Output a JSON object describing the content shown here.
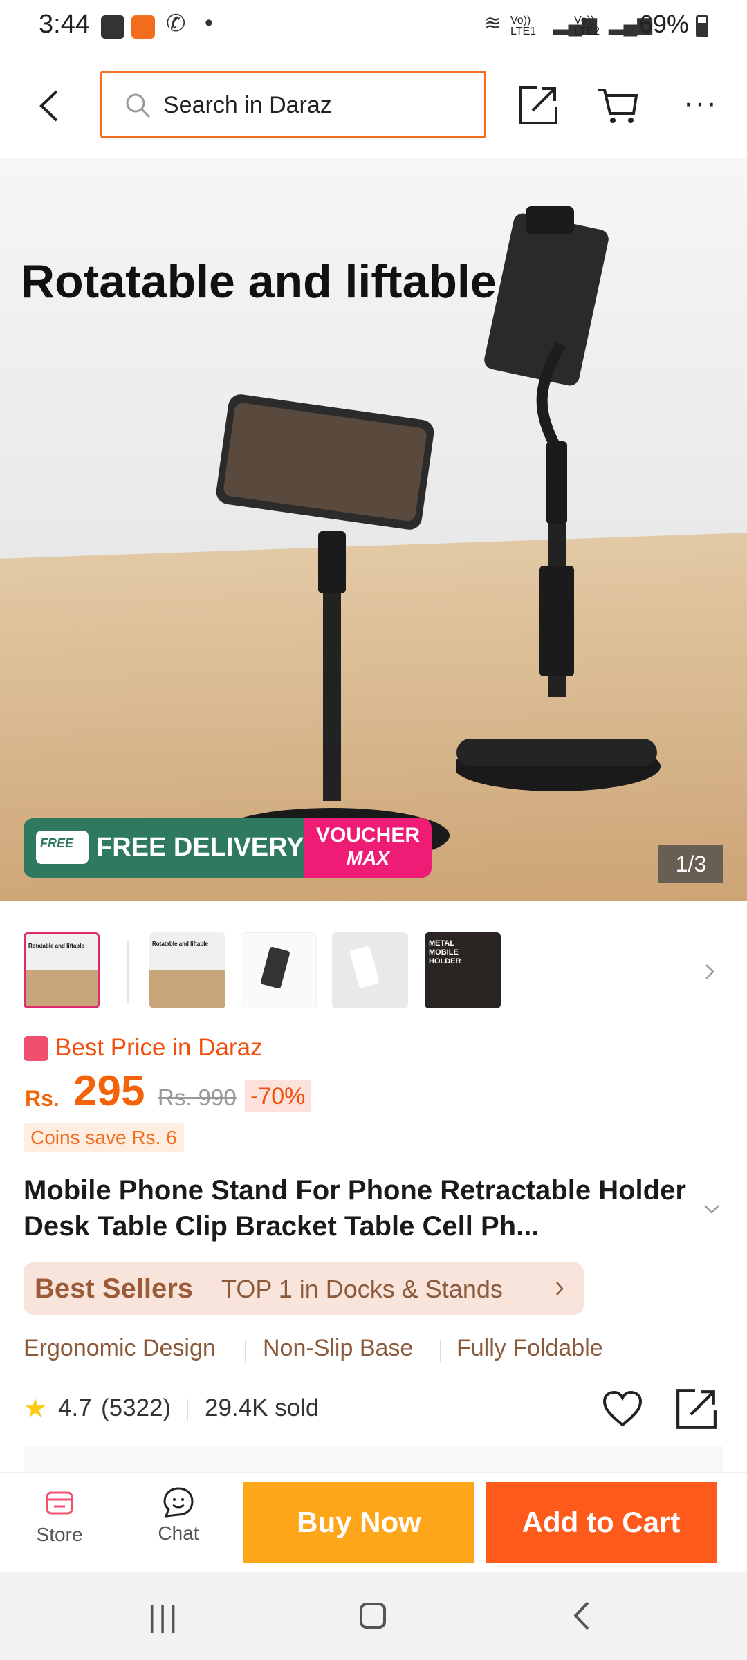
{
  "status_bar": {
    "time": "3:44",
    "battery": "69%",
    "sim1": "Vo)) LTE1",
    "sim2": "Vo)) LTE2"
  },
  "header": {
    "search_placeholder": "Search in Daraz"
  },
  "hero": {
    "title": "Rotatable and liftable",
    "free_delivery": "FREE DELIVERY",
    "free_badge": "FREE",
    "voucher_line1": "VOUCHER",
    "voucher_line2": "MAX",
    "counter": "1/3"
  },
  "thumbs": [
    "Rotatable and liftable",
    "Rotatable and liftable",
    "",
    "",
    "METAL MOBILE HOLDER"
  ],
  "price": {
    "best_price": "Best Price in Daraz",
    "currency": "Rs.",
    "amount": "295",
    "original": "Rs. 990",
    "discount": "-70%",
    "coins": "Coins save Rs. 6"
  },
  "product": {
    "title": "Mobile Phone Stand For Phone Retractable Holder Desk Table Clip Bracket Table Cell Ph...",
    "best_sellers": "Best Sellers",
    "rank": "TOP 1 in Docks & Stands",
    "features": [
      "Ergonomic Design",
      "Non-Slip Base",
      "Fully Foldable"
    ],
    "rating": "4.7",
    "reviews": "(5322)",
    "sold": "29.4K sold"
  },
  "bottom": {
    "store": "Store",
    "chat": "Chat",
    "buy_now": "Buy Now",
    "add_to_cart": "Add to Cart"
  },
  "colors": {
    "accent": "#f36d1f",
    "buy": "#fda61a",
    "cart": "#fe5a1b",
    "voucher": "#ef1c76",
    "delivery": "#2f7a5f"
  }
}
